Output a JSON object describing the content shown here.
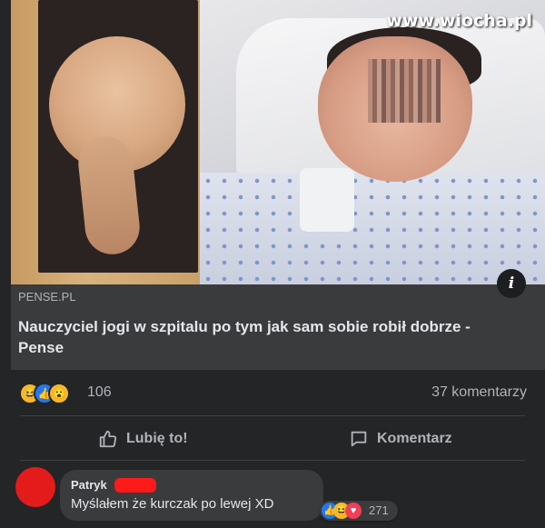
{
  "image": {
    "watermark": "www.wiocha.pl"
  },
  "link_preview": {
    "domain": "PENSE.PL",
    "title": "Nauczyciel jogi w szpitalu po tym jak sam sobie robił dobrze - Pense",
    "info_icon": "info-icon"
  },
  "reactions": {
    "icons": [
      "haha-icon",
      "like-icon",
      "wow-icon"
    ],
    "count": "106",
    "comments": "37 komentarzy"
  },
  "actions": {
    "like_label": "Lubię to!",
    "comment_label": "Komentarz"
  },
  "comment": {
    "author": "Patryk",
    "text": "Myślałem że kurczak po lewej XD",
    "reaction_icons": [
      "like-icon",
      "haha-icon",
      "love-icon"
    ],
    "reaction_count": "271"
  },
  "colors": {
    "background": "#242526",
    "card": "#3a3b3c",
    "text": "#e4e6eb",
    "muted": "#b0b3b8",
    "like_blue": "#2078f4",
    "redaction_red": "#ff1a1a"
  }
}
